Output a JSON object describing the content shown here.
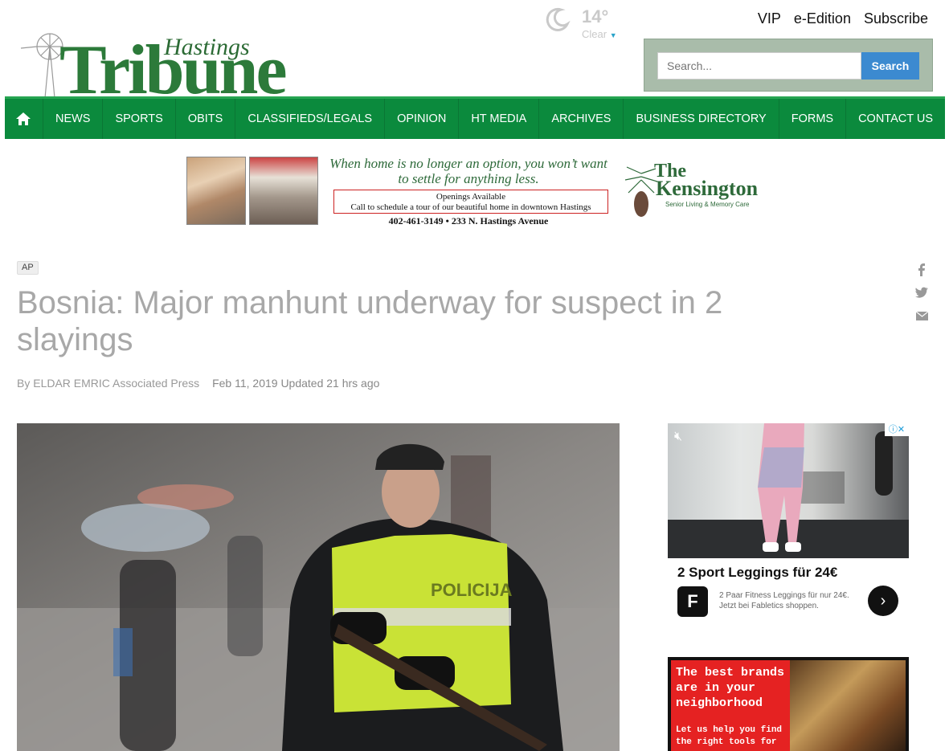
{
  "header": {
    "logo_small": "Hastings",
    "logo_large": "Tribune",
    "top_links": [
      "VIP",
      "e-Edition",
      "Subscribe"
    ]
  },
  "weather": {
    "temp": "14°",
    "condition": "Clear",
    "icon": "moon-icon"
  },
  "search": {
    "placeholder": "Search...",
    "button": "Search"
  },
  "nav": {
    "home_icon": "home-icon",
    "items": [
      "NEWS",
      "SPORTS",
      "OBITS",
      "CLASSIFIEDS/LEGALS",
      "OPINION",
      "HT MEDIA",
      "ARCHIVES",
      "BUSINESS DIRECTORY",
      "FORMS",
      "CONTACT US"
    ]
  },
  "banner_ad": {
    "tagline": "When home is no longer an option, you won’t want to settle for anything less.",
    "box_line1": "Openings Available",
    "box_line2": "Call to schedule a tour of our beautiful home in downtown Hastings",
    "phone": "402-461-3149 • 233 N. Hastings Avenue",
    "brand_the": "The",
    "brand_name": "Kensington",
    "brand_sub": "Senior Living & Memory Care"
  },
  "article": {
    "badge": "AP",
    "headline": "Bosnia: Major manhunt underway for suspect in 2 slayings",
    "byline": "By ELDAR EMRIC Associated Press",
    "date": "Feb 11, 2019 Updated 21 hrs ago",
    "image_caption_text": "POLICIJA"
  },
  "share": [
    "facebook-icon",
    "twitter-icon",
    "email-icon"
  ],
  "side_ad_1": {
    "title": "2 Sport Leggings für 24€",
    "desc": "2 Paar Fitness Leggings für nur 24€. Jetzt bei Fabletics shoppen.",
    "go": "›"
  },
  "side_ad_2": {
    "headline": "The best brands are in your neighborhood",
    "body": "Let us help you find the right tools for"
  },
  "colors": {
    "nav_green": "#0b8a3d",
    "search_blue": "#3c8ad0",
    "logo_green": "#2c7a3a"
  }
}
